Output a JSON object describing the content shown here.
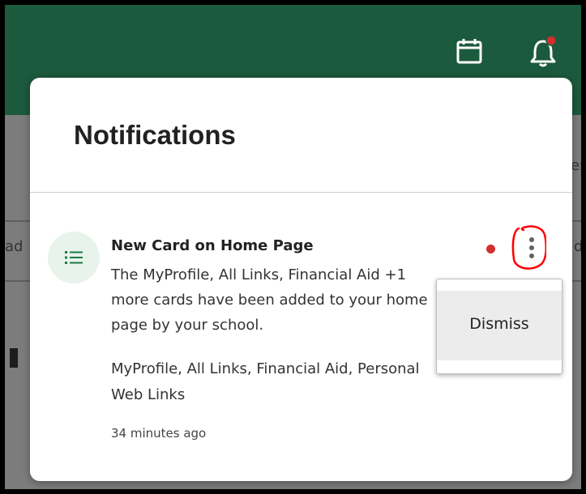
{
  "topbar": {
    "calendar_icon": "calendar-icon",
    "bell_icon": "bell-icon",
    "bell_badge_color": "#d32f2f",
    "background_color": "#1c5a3d"
  },
  "background": {
    "left_fragment": "ad",
    "right_fragment_1": "er",
    "right_fragment_2": "d"
  },
  "panel": {
    "title": "Notifications"
  },
  "notification": {
    "icon": "list-icon",
    "title": "New Card on Home Page",
    "body": "The MyProfile, All Links, Financial Aid +1 more cards have been added to your home page by your school.",
    "cards": "MyProfile, All Links, Financial Aid, Personal Web Links",
    "time": "34 minutes ago",
    "unread_color": "#d32f2f",
    "more_icon": "more-vertical-icon"
  },
  "menu": {
    "dismiss_label": "Dismiss"
  }
}
